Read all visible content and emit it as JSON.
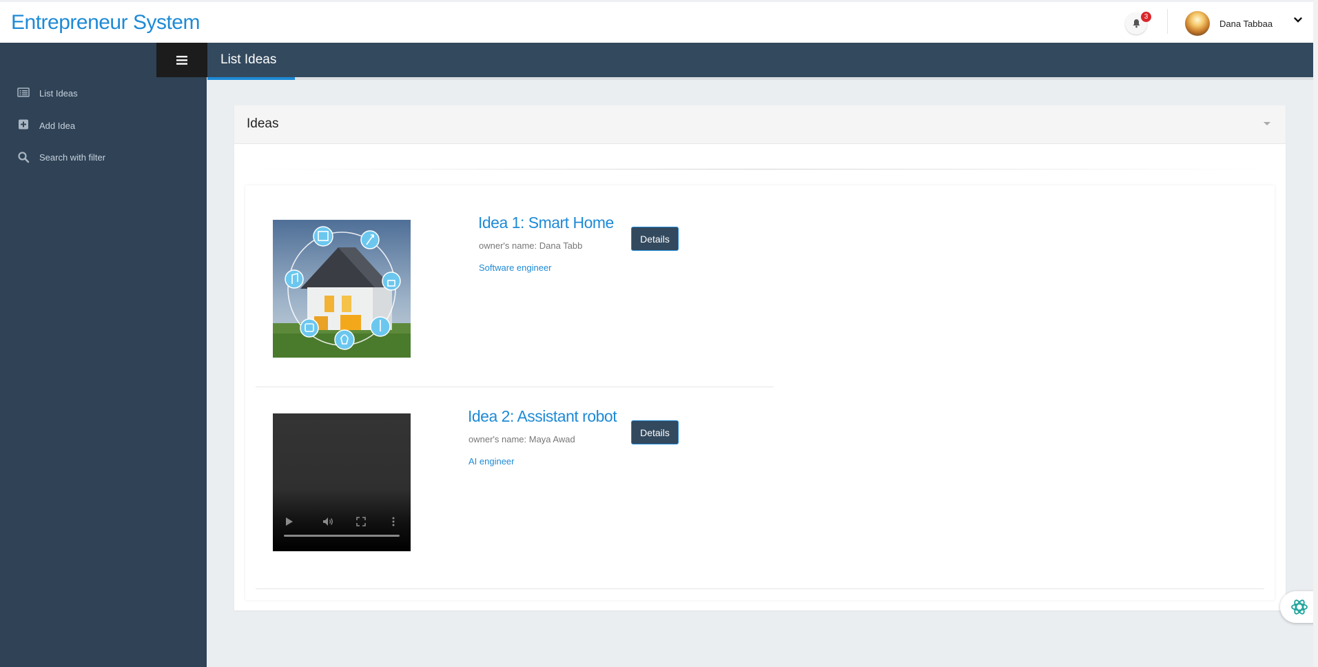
{
  "app": {
    "brand": "Entrepreneur System"
  },
  "topbar": {
    "notification_count": "3",
    "user_name": "Dana Tabbaa"
  },
  "sidebar": {
    "items": [
      {
        "label": "List Ideas",
        "icon": "list-icon"
      },
      {
        "label": "Add Idea",
        "icon": "plus-square-icon"
      },
      {
        "label": "Search with filter",
        "icon": "search-icon"
      }
    ]
  },
  "header": {
    "title": "List Ideas"
  },
  "panel": {
    "title": "Ideas",
    "ideas": [
      {
        "title": "Idea 1: Smart Home",
        "owner": "owner's name: Dana Tabb",
        "role": "Software engineer",
        "details_label": "Details",
        "media": "image"
      },
      {
        "title": "Idea 2: Assistant robot",
        "owner": "owner's name: Maya Awad",
        "role": "AI engineer",
        "details_label": "Details",
        "media": "video"
      }
    ]
  },
  "colors": {
    "accent": "#1e8ad6",
    "sidebar_bg": "#2f4256",
    "header_bg": "#33495e",
    "badge": "#d9262b"
  }
}
